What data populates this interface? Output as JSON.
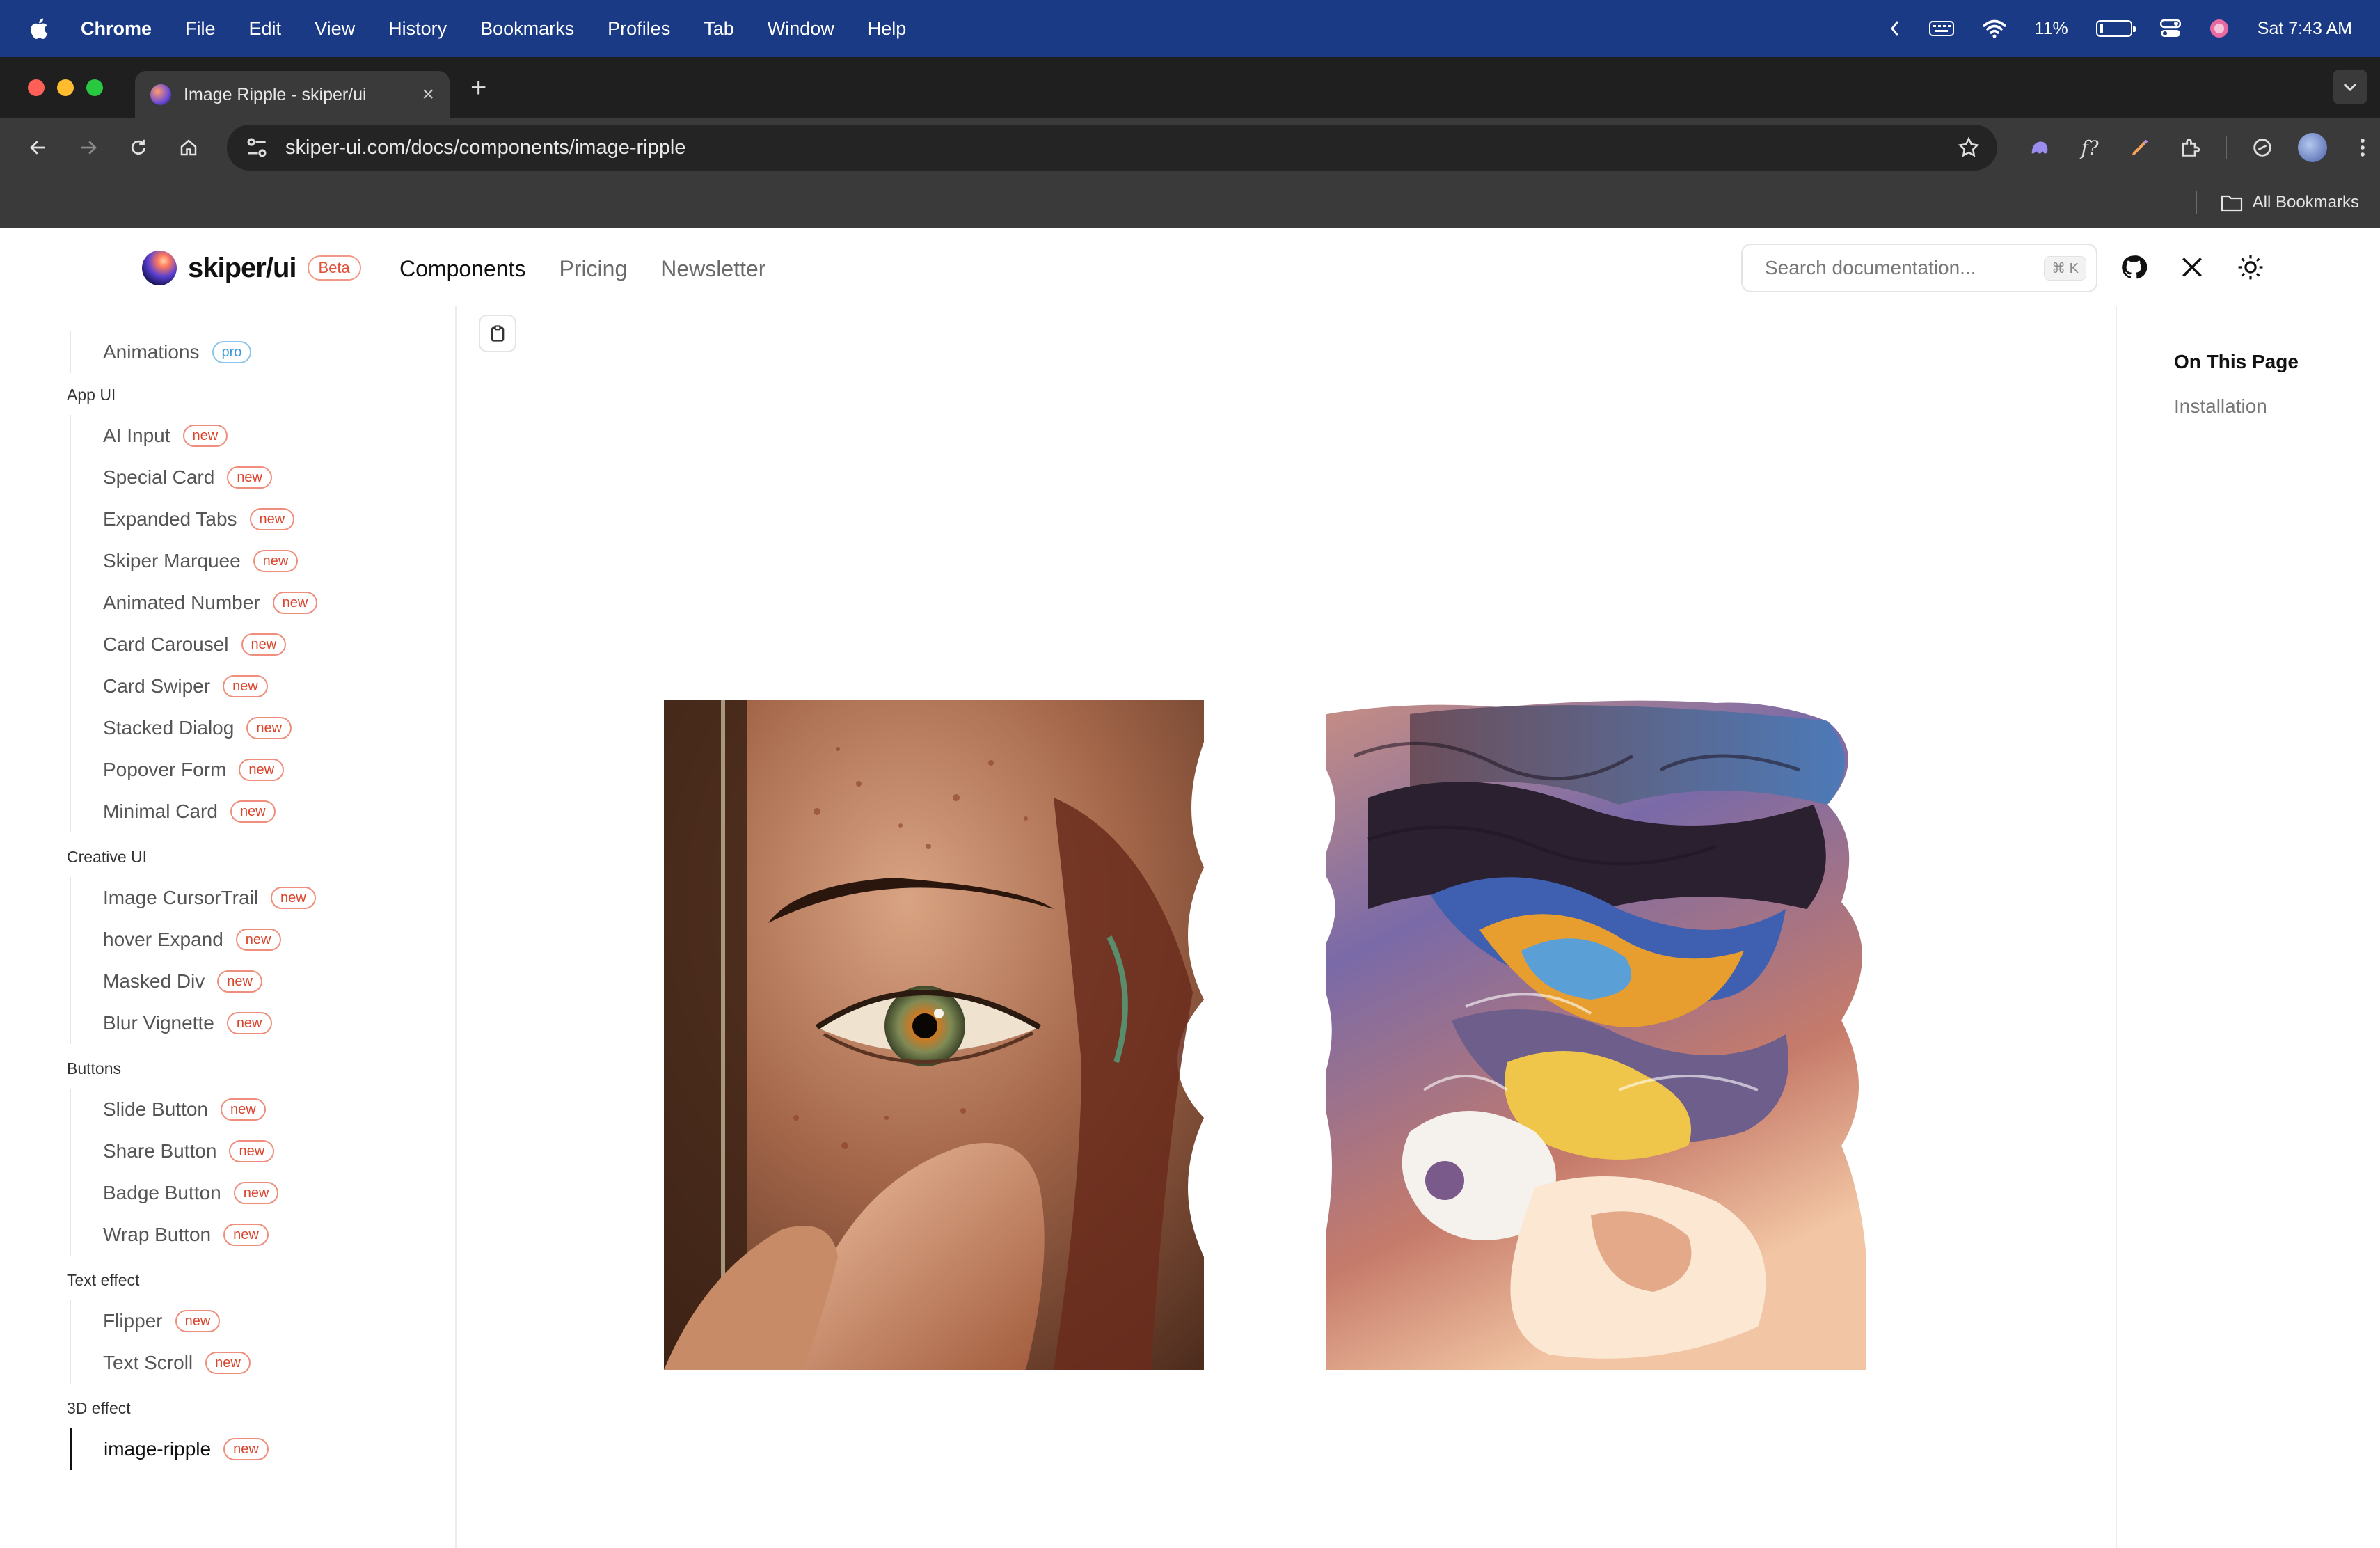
{
  "menubar": {
    "app": "Chrome",
    "items": [
      "File",
      "Edit",
      "View",
      "History",
      "Bookmarks",
      "Profiles",
      "Tab",
      "Window",
      "Help"
    ],
    "battery_percent": "11%",
    "battery_level": 0.11,
    "clock": "Sat 7:43 AM"
  },
  "browser": {
    "tab_title": "Image Ripple - skiper/ui",
    "url": "skiper-ui.com/docs/components/image-ripple",
    "bookmarks_label": "All Bookmarks"
  },
  "site": {
    "logo_text": "skiper/ui",
    "beta_label": "Beta",
    "nav": [
      "Components",
      "Pricing",
      "Newsletter"
    ],
    "search_placeholder": "Search documentation...",
    "search_shortcut": "⌘ K"
  },
  "sidebar": {
    "top_item": {
      "label": "Animations",
      "badge": "pro"
    },
    "sections": [
      {
        "title": "App UI",
        "items": [
          {
            "label": "AI Input",
            "badge": "new"
          },
          {
            "label": "Special Card",
            "badge": "new"
          },
          {
            "label": "Expanded Tabs",
            "badge": "new"
          },
          {
            "label": "Skiper Marquee",
            "badge": "new"
          },
          {
            "label": "Animated Number",
            "badge": "new"
          },
          {
            "label": "Card Carousel",
            "badge": "new"
          },
          {
            "label": "Card Swiper",
            "badge": "new"
          },
          {
            "label": "Stacked Dialog",
            "badge": "new"
          },
          {
            "label": "Popover Form",
            "badge": "new"
          },
          {
            "label": "Minimal Card",
            "badge": "new"
          }
        ]
      },
      {
        "title": "Creative UI",
        "items": [
          {
            "label": "Image CursorTrail",
            "badge": "new"
          },
          {
            "label": "hover Expand",
            "badge": "new"
          },
          {
            "label": "Masked Div",
            "badge": "new"
          },
          {
            "label": "Blur Vignette",
            "badge": "new"
          }
        ]
      },
      {
        "title": "Buttons",
        "items": [
          {
            "label": "Slide Button",
            "badge": "new"
          },
          {
            "label": "Share Button",
            "badge": "new"
          },
          {
            "label": "Badge Button",
            "badge": "new"
          },
          {
            "label": "Wrap Button",
            "badge": "new"
          }
        ]
      },
      {
        "title": "Text effect",
        "items": [
          {
            "label": "Flipper",
            "badge": "new"
          },
          {
            "label": "Text Scroll",
            "badge": "new"
          }
        ]
      },
      {
        "title": "3D effect",
        "items": [
          {
            "label": "image-ripple",
            "badge": "new",
            "active": true
          }
        ]
      }
    ]
  },
  "toc": {
    "title": "On This Page",
    "links": [
      "Installation"
    ]
  },
  "colors": {
    "menubar_bg": "#1a3a86",
    "badge_new": "#d9452c",
    "badge_pro": "#3a9ad9"
  },
  "icons": {
    "menubar": [
      "apple-icon",
      "chevron-left-icon",
      "keyboard-icon",
      "wifi-icon",
      "battery-icon",
      "control-center-icon",
      "siri-icon"
    ],
    "toolbar": [
      "back-icon",
      "forward-icon",
      "reload-icon",
      "home-icon",
      "site-settings-icon",
      "star-icon"
    ],
    "header": [
      "github-icon",
      "x-icon",
      "sun-icon"
    ],
    "content": [
      "clipboard-icon"
    ]
  }
}
